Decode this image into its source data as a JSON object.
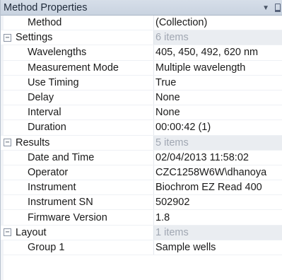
{
  "panel": {
    "title": "Method Properties",
    "title_icons": [
      "dropdown-arrow-icon",
      "pin-icon"
    ]
  },
  "rows": {
    "method": {
      "name": "Method",
      "value": "(Collection)"
    },
    "settings": {
      "name": "Settings",
      "summary": "6 items",
      "expander": "−",
      "items": [
        {
          "name": "Wavelengths",
          "value": "405, 450, 492, 620 nm"
        },
        {
          "name": "Measurement Mode",
          "value": "Multiple wavelength"
        },
        {
          "name": "Use Timing",
          "value": "True"
        },
        {
          "name": "Delay",
          "value": "None"
        },
        {
          "name": "Interval",
          "value": "None"
        },
        {
          "name": "Duration",
          "value": "00:00:42 (1)"
        }
      ]
    },
    "results": {
      "name": "Results",
      "summary": "5 items",
      "expander": "−",
      "items": [
        {
          "name": "Date and Time",
          "value": "02/04/2013 11:58:02"
        },
        {
          "name": "Operator",
          "value": "CZC1258W6W\\dhanoya"
        },
        {
          "name": "Instrument",
          "value": "Biochrom EZ Read 400"
        },
        {
          "name": "Instrument SN",
          "value": "502902"
        },
        {
          "name": "Firmware Version",
          "value": "1.8"
        }
      ]
    },
    "layout": {
      "name": "Layout",
      "summary": "1 items",
      "expander": "−",
      "items": [
        {
          "name": "Group 1",
          "value": "Sample wells"
        }
      ]
    }
  }
}
